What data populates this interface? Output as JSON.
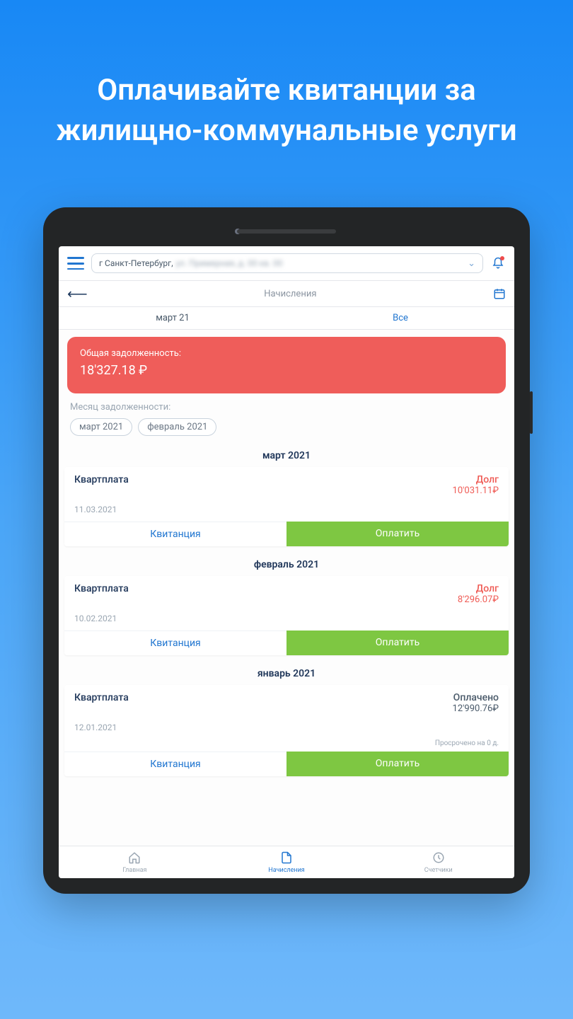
{
  "heading": "Оплачивайте квитанции за жилищно-коммунальные услуги",
  "address": {
    "visible_prefix": "г Санкт-Петербург,",
    "redacted_suffix": "ул. Примерная, д. 00 кв. 00"
  },
  "subheader_title": "Начисления",
  "filter": {
    "current_month": "март 21",
    "all_label": "Все"
  },
  "debt": {
    "label": "Общая задолженность:",
    "amount": "18'327.18 ₽"
  },
  "month_of_debt_label": "Месяц задолженности:",
  "chips": [
    "март 2021",
    "февраль 2021"
  ],
  "sections": [
    {
      "header": "март 2021",
      "card": {
        "name": "Квартплата",
        "status_text": "Долг",
        "status_kind": "debt",
        "amount": "10'031.11₽",
        "amount_kind": "red",
        "date": "11.03.2021",
        "overdue": "",
        "receipt_label": "Квитанция",
        "pay_label": "Оплатить"
      }
    },
    {
      "header": "февраль 2021",
      "card": {
        "name": "Квартплата",
        "status_text": "Долг",
        "status_kind": "debt",
        "amount": "8'296.07₽",
        "amount_kind": "red",
        "date": "10.02.2021",
        "overdue": "",
        "receipt_label": "Квитанция",
        "pay_label": "Оплатить"
      }
    },
    {
      "header": "январь 2021",
      "card": {
        "name": "Квартплата",
        "status_text": "Оплачено",
        "status_kind": "paid",
        "amount": "12'990.76₽",
        "amount_kind": "dark",
        "date": "12.01.2021",
        "overdue": "Просрочено на 0 д.",
        "receipt_label": "Квитанция",
        "pay_label": "Оплатить"
      }
    }
  ],
  "nav": {
    "home": "Главная",
    "charges": "Начисления",
    "meters": "Счетчики"
  }
}
